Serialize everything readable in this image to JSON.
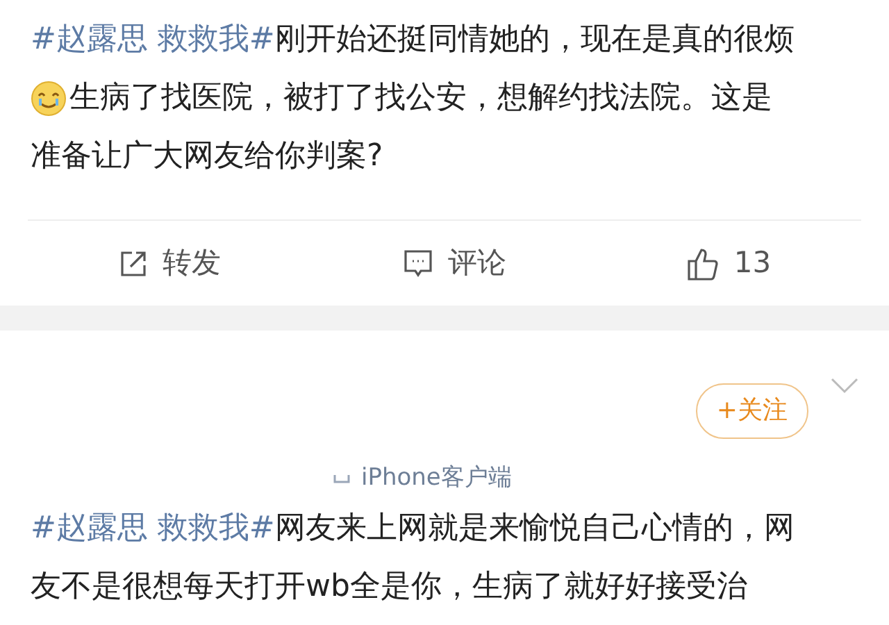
{
  "posts": [
    {
      "hashtag": "#赵露思 救救我#",
      "lines": [
        {
          "text": "刚开始还挺同情她的，现在是真的很烦",
          "emoji_before": false
        },
        {
          "text": "生病了找医院，被打了找公安，想解约找法院。这是",
          "emoji_before": true
        },
        {
          "text": "准备让广大网友给你判案?",
          "emoji_before": false
        }
      ],
      "actions": [
        {
          "kind": "repost",
          "label": "转发"
        },
        {
          "kind": "comment",
          "label": "评论"
        },
        {
          "kind": "like",
          "label": "13"
        }
      ]
    },
    {
      "source": "iPhone客户端",
      "follow_label": "+关注",
      "hashtag": "#赵露思 救救我#",
      "lines": [
        {
          "text": "网友来上网就是来愉悦自己心情的，网",
          "emoji_before": false
        },
        {
          "text": "友不是很想每天打开wb全是你，生病了就好好接受治",
          "emoji_before": false
        }
      ]
    }
  ]
}
